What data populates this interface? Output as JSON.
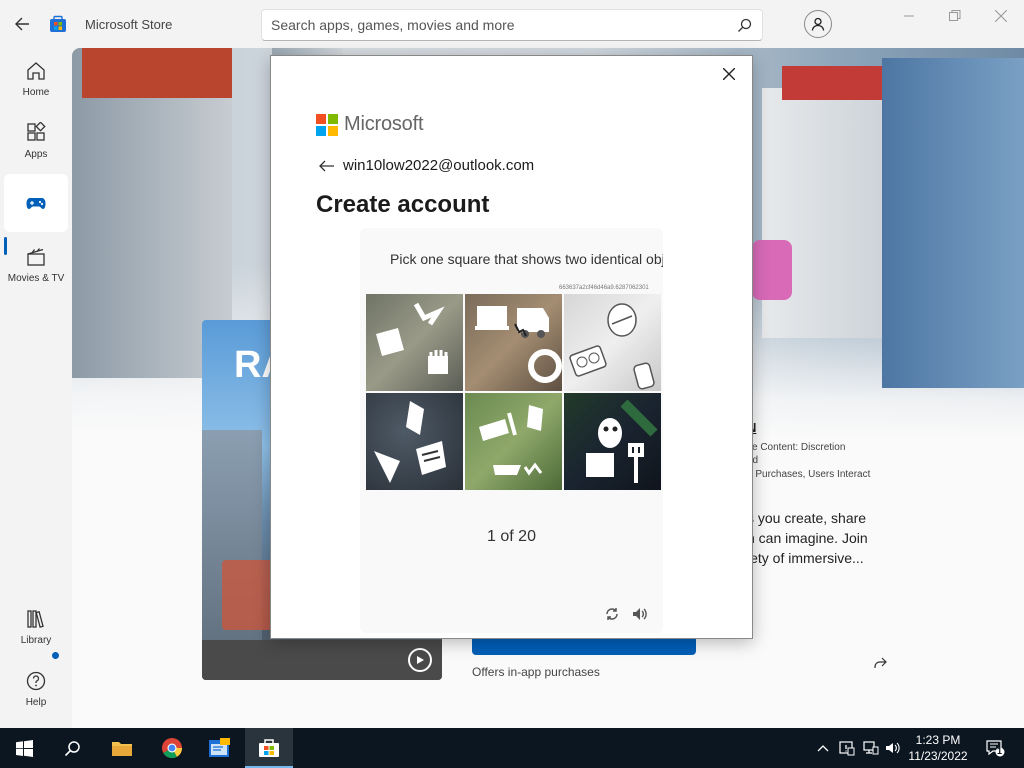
{
  "app": {
    "title": "Microsoft Store"
  },
  "search": {
    "placeholder": "Search apps, games, movies and more"
  },
  "sidebar": {
    "items": [
      {
        "label": "Home"
      },
      {
        "label": "Apps"
      },
      {
        "label": "Gaming"
      },
      {
        "label": "Movies & TV"
      },
      {
        "label": "Library"
      },
      {
        "label": "Help"
      }
    ]
  },
  "product": {
    "thumb_title": "RA",
    "rating_title": "N",
    "rating_lines": [
      "se Content: Discretion",
      "ed",
      "p Purchases, Users Interact"
    ],
    "description": [
      "s you create, share",
      "n can imagine. Join",
      "iety of immersive..."
    ],
    "offers": "Offers in-app purchases"
  },
  "dialog": {
    "brand": "Microsoft",
    "email": "win10low2022@outlook.com",
    "heading": "Create account",
    "captcha": {
      "prompt": "Pick one square that shows two identical objects.",
      "challenge_id": "663637a2cf46d46a9.6287062301",
      "progress": "1 of 20"
    }
  },
  "taskbar": {
    "time": "1:23 PM",
    "date": "11/23/2022",
    "notification_count": "1"
  },
  "colors": {
    "accent": "#005fb8",
    "taskbar": "#0b1620"
  }
}
